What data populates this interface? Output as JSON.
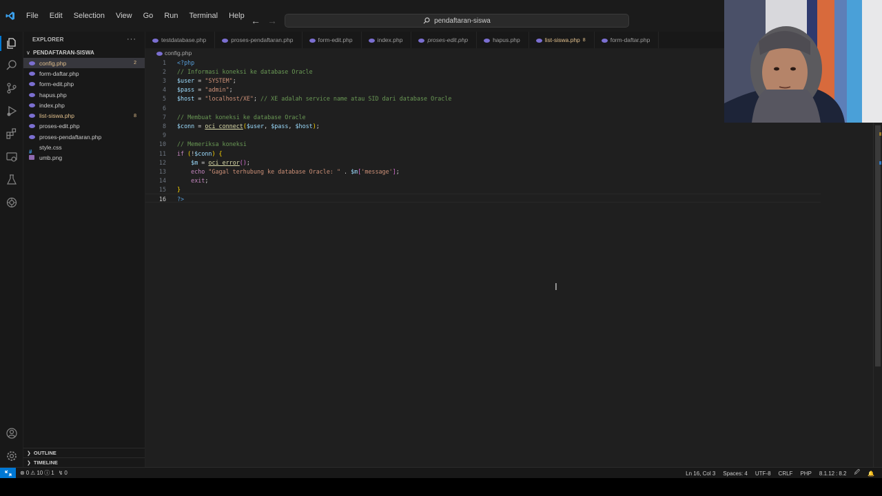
{
  "colors": {
    "accent": "#0078d4",
    "editor_bg": "#1f1f1f",
    "sidebar_bg": "#181818",
    "modified": "#e2c08d"
  },
  "menu": [
    "File",
    "Edit",
    "Selection",
    "View",
    "Go",
    "Run",
    "Terminal",
    "Help"
  ],
  "command_center": {
    "label": "pendaftaran-siswa",
    "icon": "search-icon"
  },
  "activity_bar": {
    "top": [
      "files-icon",
      "search-icon",
      "source-control-icon",
      "run-debug-icon",
      "extensions-icon",
      "remote-explorer-icon",
      "testing-icon",
      "openai-icon"
    ],
    "bottom": [
      "account-icon",
      "settings-gear-icon"
    ]
  },
  "explorer": {
    "title": "EXPLORER",
    "folder": "PENDAFTARAN-SISWA",
    "files": [
      {
        "name": "config.php",
        "type": "php",
        "badge": "2",
        "modified": true,
        "selected": true
      },
      {
        "name": "form-daftar.php",
        "type": "php",
        "badge": "",
        "modified": false
      },
      {
        "name": "form-edit.php",
        "type": "php",
        "badge": "",
        "modified": false
      },
      {
        "name": "hapus.php",
        "type": "php",
        "badge": "",
        "modified": false
      },
      {
        "name": "index.php",
        "type": "php",
        "badge": "",
        "modified": false
      },
      {
        "name": "list-siswa.php",
        "type": "php",
        "badge": "8",
        "modified": true
      },
      {
        "name": "proses-edit.php",
        "type": "php",
        "badge": "",
        "modified": false
      },
      {
        "name": "proses-pendaftaran.php",
        "type": "php",
        "badge": "",
        "modified": false
      },
      {
        "name": "style.css",
        "type": "css",
        "badge": "",
        "modified": false
      },
      {
        "name": "umb.png",
        "type": "png",
        "badge": "",
        "modified": false
      }
    ],
    "outline": "OUTLINE",
    "timeline": "TIMELINE"
  },
  "tabs": [
    {
      "label": "testdatabase.php",
      "italic": false,
      "modified": false,
      "badge": ""
    },
    {
      "label": "proses-pendaftaran.php",
      "italic": false,
      "modified": false,
      "badge": ""
    },
    {
      "label": "form-edit.php",
      "italic": false,
      "modified": false,
      "badge": ""
    },
    {
      "label": "index.php",
      "italic": false,
      "modified": false,
      "badge": ""
    },
    {
      "label": "proses-edit.php",
      "italic": true,
      "modified": false,
      "badge": ""
    },
    {
      "label": "hapus.php",
      "italic": false,
      "modified": false,
      "badge": ""
    },
    {
      "label": "list-siswa.php",
      "italic": false,
      "modified": true,
      "badge": "8"
    },
    {
      "label": "form-daftar.php",
      "italic": false,
      "modified": false,
      "badge": ""
    }
  ],
  "breadcrumb": "config.php",
  "code": [
    {
      "n": "1",
      "t": [
        [
          "tk-tag",
          "<?php"
        ]
      ]
    },
    {
      "n": "2",
      "t": [
        [
          "tk-com",
          "// Informasi koneksi ke database Oracle"
        ]
      ]
    },
    {
      "n": "3",
      "t": [
        [
          "tk-var",
          "$user"
        ],
        [
          "tk-op",
          " = "
        ],
        [
          "tk-str",
          "\"SYSTEM\""
        ],
        [
          "tk-op",
          ";"
        ]
      ]
    },
    {
      "n": "4",
      "t": [
        [
          "tk-var",
          "$pass"
        ],
        [
          "tk-op",
          " = "
        ],
        [
          "tk-str",
          "\"admin\""
        ],
        [
          "tk-op",
          ";"
        ]
      ]
    },
    {
      "n": "5",
      "t": [
        [
          "tk-var",
          "$host"
        ],
        [
          "tk-op",
          " = "
        ],
        [
          "tk-str",
          "\"localhost/XE\""
        ],
        [
          "tk-op",
          "; "
        ],
        [
          "tk-com",
          "// XE adalah service name atau SID dari database Oracle"
        ]
      ]
    },
    {
      "n": "6",
      "t": []
    },
    {
      "n": "7",
      "t": [
        [
          "tk-com",
          "// Membuat koneksi ke database Oracle"
        ]
      ]
    },
    {
      "n": "8",
      "t": [
        [
          "tk-var",
          "$conn"
        ],
        [
          "tk-op",
          " = "
        ],
        [
          "tk-fn",
          "oci_connect"
        ],
        [
          "tk-brace",
          "("
        ],
        [
          "tk-var",
          "$user"
        ],
        [
          "tk-op",
          ", "
        ],
        [
          "tk-var",
          "$pass"
        ],
        [
          "tk-op",
          ", "
        ],
        [
          "tk-var",
          "$host"
        ],
        [
          "tk-brace",
          ")"
        ],
        [
          "tk-op",
          ";"
        ]
      ]
    },
    {
      "n": "9",
      "t": []
    },
    {
      "n": "10",
      "t": [
        [
          "tk-com",
          "// Memeriksa koneksi"
        ]
      ]
    },
    {
      "n": "11",
      "t": [
        [
          "tk-kw",
          "if"
        ],
        [
          "tk-op",
          " "
        ],
        [
          "tk-brace",
          "("
        ],
        [
          "tk-op",
          "!"
        ],
        [
          "tk-var",
          "$conn"
        ],
        [
          "tk-brace",
          ")"
        ],
        [
          "tk-op",
          " "
        ],
        [
          "tk-brace",
          "{"
        ]
      ]
    },
    {
      "n": "12",
      "t": [
        [
          "tk-op",
          "    "
        ],
        [
          "tk-var",
          "$m"
        ],
        [
          "tk-op",
          " = "
        ],
        [
          "tk-fn",
          "oci_error"
        ],
        [
          "tk-paren",
          "()"
        ],
        [
          "tk-op",
          ";"
        ]
      ]
    },
    {
      "n": "13",
      "t": [
        [
          "tk-op",
          "    "
        ],
        [
          "tk-kw",
          "echo"
        ],
        [
          "tk-op",
          " "
        ],
        [
          "tk-str",
          "\"Gagal terhubung ke database Oracle: \""
        ],
        [
          "tk-op",
          " . "
        ],
        [
          "tk-var",
          "$m"
        ],
        [
          "tk-paren",
          "["
        ],
        [
          "tk-str",
          "'message'"
        ],
        [
          "tk-paren",
          "]"
        ],
        [
          "tk-op",
          ";"
        ]
      ]
    },
    {
      "n": "14",
      "t": [
        [
          "tk-op",
          "    "
        ],
        [
          "tk-kw",
          "exit"
        ],
        [
          "tk-op",
          ";"
        ]
      ]
    },
    {
      "n": "15",
      "t": [
        [
          "tk-brace",
          "}"
        ]
      ]
    },
    {
      "n": "16",
      "t": [
        [
          "tk-tag",
          "?>"
        ]
      ],
      "current": true
    }
  ],
  "status": {
    "problems": "0",
    "warnings": "10",
    "info": "1",
    "ports": "0",
    "position": "Ln 16, Col 3",
    "spaces": "Spaces: 4",
    "encoding": "UTF-8",
    "eol": "CRLF",
    "language": "PHP",
    "php_version": "8.1.12",
    "php_version_short": "8.2"
  }
}
